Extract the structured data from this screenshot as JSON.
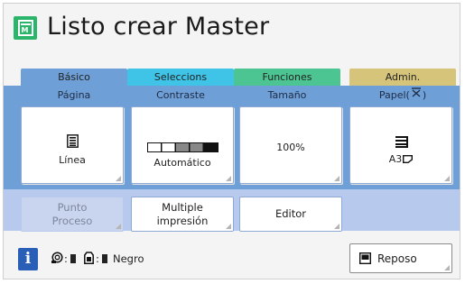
{
  "header": {
    "title": "Listo crear Master",
    "icon": "master-icon"
  },
  "tabs": [
    {
      "label": "Básico",
      "color": "#6e9fd6"
    },
    {
      "label": "Seleccions",
      "color": "#3fc3e7"
    },
    {
      "label": "Funciones",
      "color": "#4cc593"
    },
    {
      "label": "Admin.",
      "color": "#d6c47a"
    }
  ],
  "settings": [
    {
      "header": "Página",
      "value": "Línea",
      "icon": "document-icon"
    },
    {
      "header": "Contraste",
      "value": "Automático",
      "icon": "contrast-scale-icon"
    },
    {
      "header": "Tamaño",
      "value": "100%"
    },
    {
      "header": "Papel(",
      "header_suffix": ")",
      "value": "A3",
      "icon": "paper-tray-icon"
    }
  ],
  "buttons": {
    "punto_proceso": "Punto\nProceso",
    "multiple": "Multiple\nimpresión",
    "editor": "Editor"
  },
  "status": {
    "separator1": ":",
    "separator2": ":",
    "ink_color": "Negro",
    "reposo": "Reposo"
  }
}
